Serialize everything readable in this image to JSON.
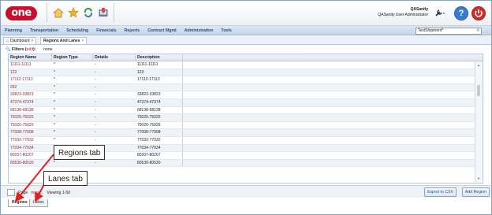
{
  "header": {
    "logo": "one",
    "user_name": "QASanity",
    "user_role": "QASanity User Administrator",
    "icons": [
      "home-icon",
      "star-icon",
      "refresh-icon",
      "inbox-icon"
    ],
    "help_label": "?"
  },
  "menu": {
    "items": [
      "Planning",
      "Transportation",
      "Scheduling",
      "Financials",
      "Reports",
      "Contract Mgmt",
      "Administration",
      "Tools"
    ],
    "search_value": "TestShipment*"
  },
  "page_tabs": [
    {
      "label": "Dashboard",
      "close": "×"
    },
    {
      "label": "Regions And Lanes",
      "close": "×"
    }
  ],
  "filters": {
    "label": "Filters (",
    "edit": "edit",
    "label_end": "):",
    "value": "none"
  },
  "grid": {
    "columns": [
      "Region Name",
      "Region Type",
      "Details",
      "Description"
    ],
    "rows": [
      {
        "name": "11111-11111",
        "type": "*",
        "details": "-",
        "desc": "11111-11111"
      },
      {
        "name": "123",
        "type": "*",
        "details": "-",
        "desc": "123"
      },
      {
        "name": "17112-17112",
        "type": "*",
        "details": "-",
        "desc": "17112-17112"
      },
      {
        "name": "292",
        "type": "*",
        "details": "-",
        "desc": ""
      },
      {
        "name": "33823-33823",
        "type": "*",
        "details": "-",
        "desc": "33823-33823"
      },
      {
        "name": "47374-47374",
        "type": "*",
        "details": "-",
        "desc": "47374-47374"
      },
      {
        "name": "68138-68138",
        "type": "*",
        "details": "-",
        "desc": "68138-68138"
      },
      {
        "name": "75025-75025",
        "type": "*",
        "details": "-",
        "desc": "75025-75025"
      },
      {
        "name": "75026-75026",
        "type": "*",
        "details": "-",
        "desc": "75026-75026"
      },
      {
        "name": "77008-77008",
        "type": "*",
        "details": "-",
        "desc": "77008-77008"
      },
      {
        "name": "77032-77032",
        "type": "*",
        "details": "-",
        "desc": "77032-77032"
      },
      {
        "name": "77034-77034",
        "type": "*",
        "details": "-",
        "desc": "77034-77034"
      },
      {
        "name": "80207-80207",
        "type": "*",
        "details": "-",
        "desc": "80207-80207"
      },
      {
        "name": "80530-80530",
        "type": "*",
        "details": "-",
        "desc": "80530-80530"
      }
    ]
  },
  "footer": {
    "page_label": "Page",
    "more": "more...",
    "viewing": "Viewing 1-50",
    "export_btn": "Export to CSV",
    "add_btn": "Add Region"
  },
  "bottom_tabs": [
    "Regions",
    "Lanes"
  ],
  "callouts": {
    "regions_tab": "Regions tab",
    "lanes_tab": "Lanes tab"
  },
  "colors": {
    "brand": "#c8102e",
    "menu_text": "#1f4e8a",
    "link": "#8a2740"
  }
}
